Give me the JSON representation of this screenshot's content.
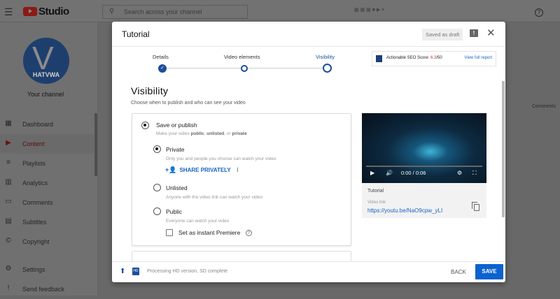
{
  "app": {
    "logo_text": "Studio",
    "search_placeholder": "Search across your channel"
  },
  "sidebar": {
    "channel_label": "Your channel",
    "avatar_text": "HATVWA",
    "items": [
      {
        "label": "Dashboard"
      },
      {
        "label": "Content",
        "active": true
      },
      {
        "label": "Playlists"
      },
      {
        "label": "Analytics"
      },
      {
        "label": "Comments"
      },
      {
        "label": "Subtitles"
      },
      {
        "label": "Copyright"
      },
      {
        "label": "Settings"
      },
      {
        "label": "Send feedback"
      }
    ]
  },
  "background": {
    "col_comments": "Comments"
  },
  "modal": {
    "title": "Tutorial",
    "draft_badge": "Saved as draft",
    "steps": [
      {
        "label": "Details",
        "state": "done"
      },
      {
        "label": "Video elements",
        "state": "todo"
      },
      {
        "label": "Visibility",
        "state": "current"
      }
    ],
    "seo": {
      "label": "Actionable SEO Score:",
      "score": "6.3",
      "max": "/50",
      "link": "View full report"
    },
    "heading": "Visibility",
    "subheading": "Choose when to publish and who can see your video",
    "save_or_publish": {
      "label": "Save or publish",
      "desc_prefix": "Make your video ",
      "public": "public",
      "sep1": ", ",
      "unlisted": "unlisted",
      "sep2": ", or ",
      "private": "private"
    },
    "options": [
      {
        "label": "Private",
        "desc": "Only you and people you choose can watch your video",
        "selected": true
      },
      {
        "label": "Unlisted",
        "desc": "Anyone with the video link can watch your video",
        "selected": false
      },
      {
        "label": "Public",
        "desc": "Everyone can watch your video",
        "selected": false
      }
    ],
    "share_privately": "SHARE PRIVATELY",
    "premiere_label": "Set as instant Premiere",
    "video": {
      "time": "0:00 / 0:06",
      "title": "Tutorial",
      "link_label": "Video link",
      "link": "https://youtu.be/NaO9cpw_yLI"
    },
    "footer": {
      "status": "Processing HD version, SD complete",
      "hd_badge": "HD",
      "back": "BACK",
      "save": "SAVE"
    }
  }
}
